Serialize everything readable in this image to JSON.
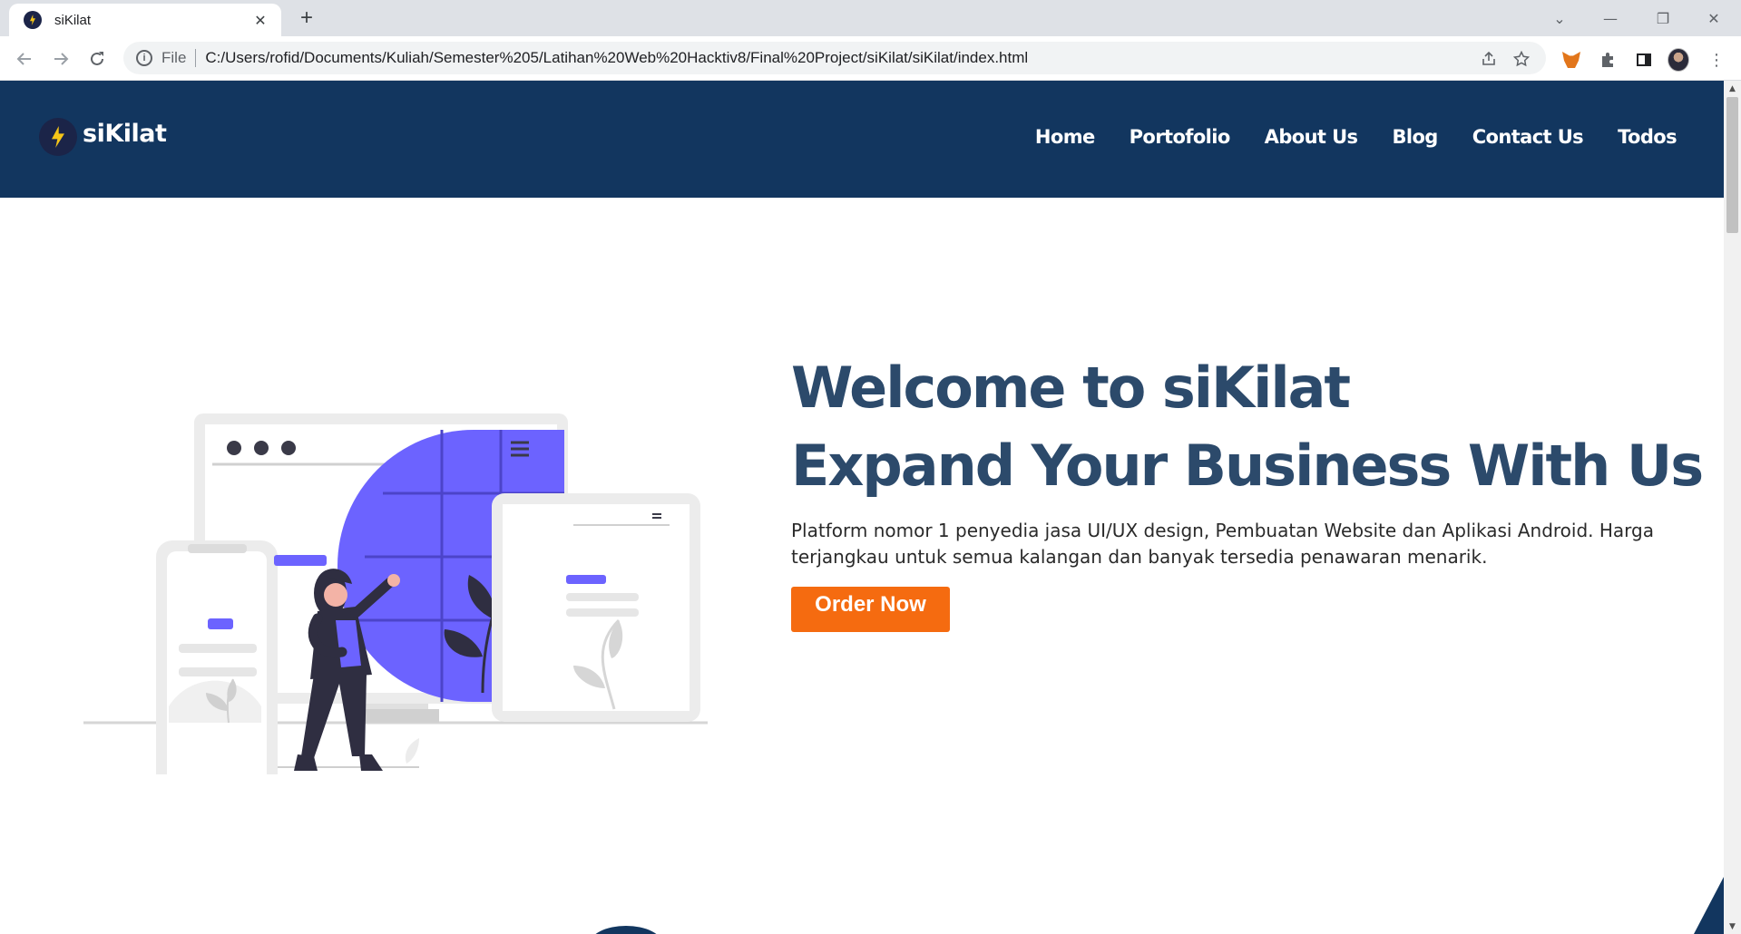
{
  "browser": {
    "tab_title": "siKilat",
    "new_tab_symbol": "+",
    "close_symbol": "✕",
    "file_label": "File",
    "url": "C:/Users/rofid/Documents/Kuliah/Semester%205/Latihan%20Web%20Hacktiv8/Final%20Project/siKilat/siKilat/index.html",
    "icons": [
      "back-icon",
      "forward-icon",
      "reload-icon",
      "info-icon",
      "share-icon",
      "bookmark-star-icon",
      "metamask-fox-icon",
      "extensions-puzzle-icon",
      "side-panel-icon",
      "profile-avatar",
      "kebab-menu-icon"
    ]
  },
  "site": {
    "logo_text": "siKilat",
    "nav": [
      "Home",
      "Portofolio",
      "About Us",
      "Blog",
      "Contact Us",
      "Todos"
    ],
    "hero": {
      "title_line1": "Welcome to siKilat",
      "title_line2": "Expand Your Business With Us",
      "description": "Platform nomor 1 penyedia jasa UI/UX design, Pembuatan Website dan Aplikasi Android. Harga terjangkau untuk semua kalangan dan banyak tersedia penawaran menarik.",
      "cta_label": "Order Now"
    },
    "colors": {
      "header_bg": "#12365f",
      "title_color": "#2c4a6b",
      "cta_bg": "#f56b10",
      "illustration_accent": "#6c63ff"
    }
  }
}
